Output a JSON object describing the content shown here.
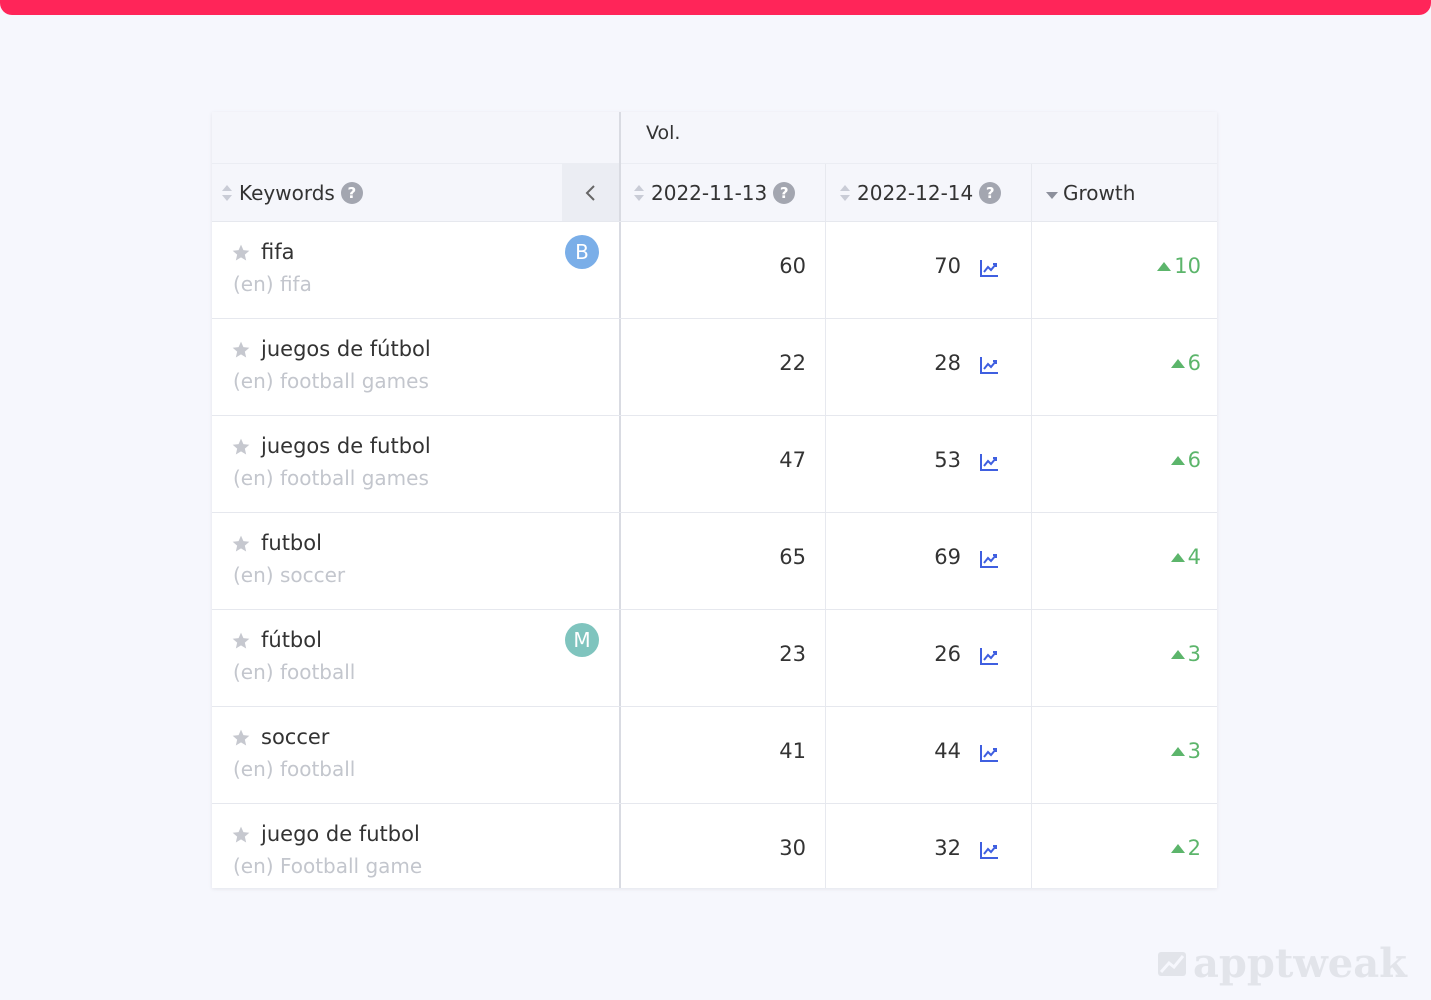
{
  "table": {
    "group_header": "Vol.",
    "columns": {
      "keywords": "Keywords",
      "date1": "2022-11-13",
      "date2": "2022-12-14",
      "growth": "Growth"
    },
    "rows": [
      {
        "keyword": "fifa",
        "translation": "(en) fifa",
        "vol1": "60",
        "vol2": "70",
        "growth": "10",
        "badge": "B",
        "badge_color": "#7aaee8"
      },
      {
        "keyword": "juegos de fútbol",
        "translation": "(en) football games",
        "vol1": "22",
        "vol2": "28",
        "growth": "6",
        "badge": "",
        "badge_color": ""
      },
      {
        "keyword": "juegos de futbol",
        "translation": "(en) football games",
        "vol1": "47",
        "vol2": "53",
        "growth": "6",
        "badge": "",
        "badge_color": ""
      },
      {
        "keyword": "futbol",
        "translation": "(en) soccer",
        "vol1": "65",
        "vol2": "69",
        "growth": "4",
        "badge": "",
        "badge_color": ""
      },
      {
        "keyword": "fútbol",
        "translation": "(en) football",
        "vol1": "23",
        "vol2": "26",
        "growth": "3",
        "badge": "M",
        "badge_color": "#7fc4be"
      },
      {
        "keyword": "soccer",
        "translation": "(en) football",
        "vol1": "41",
        "vol2": "44",
        "growth": "3",
        "badge": "",
        "badge_color": ""
      },
      {
        "keyword": "juego de futbol",
        "translation": "(en) Football game",
        "vol1": "30",
        "vol2": "32",
        "growth": "2",
        "badge": "",
        "badge_color": ""
      }
    ]
  },
  "watermark": "apptweak",
  "colors": {
    "top_bar": "#ff2559",
    "growth_positive": "#5cb56b",
    "trend_icon": "#3f5fe0"
  },
  "icons": [
    "star-icon",
    "help-icon",
    "chevron-left-icon",
    "sort-icon",
    "trend-chart-icon",
    "growth-up-icon"
  ]
}
